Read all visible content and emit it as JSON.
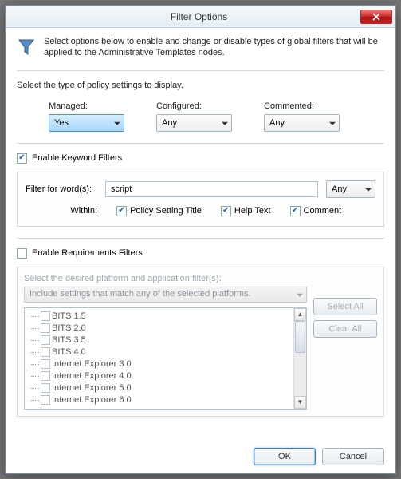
{
  "window": {
    "title": "Filter Options"
  },
  "intro": "Select options below to enable and change or disable types of global filters that will be applied to the Administrative Templates nodes.",
  "policy": {
    "heading": "Select the type of policy settings to display.",
    "managed": {
      "label": "Managed:",
      "value": "Yes"
    },
    "configured": {
      "label": "Configured:",
      "value": "Any"
    },
    "commented": {
      "label": "Commented:",
      "value": "Any"
    }
  },
  "keyword": {
    "enable_label": "Enable Keyword Filters",
    "enabled": true,
    "filter_label": "Filter for word(s):",
    "value": "script",
    "match_value": "Any",
    "within_label": "Within:",
    "opt_title": "Policy Setting Title",
    "opt_help": "Help Text",
    "opt_comment": "Comment"
  },
  "req": {
    "enable_label": "Enable Requirements Filters",
    "enabled": false,
    "desc": "Select the desired platform and application filter(s):",
    "combo_value": "Include settings that match any of the selected platforms.",
    "items": [
      "BITS 1.5",
      "BITS 2.0",
      "BITS 3.5",
      "BITS 4.0",
      "Internet Explorer 3.0",
      "Internet Explorer 4.0",
      "Internet Explorer 5.0",
      "Internet Explorer 6.0"
    ],
    "select_all": "Select All",
    "clear_all": "Clear All"
  },
  "buttons": {
    "ok": "OK",
    "cancel": "Cancel"
  }
}
